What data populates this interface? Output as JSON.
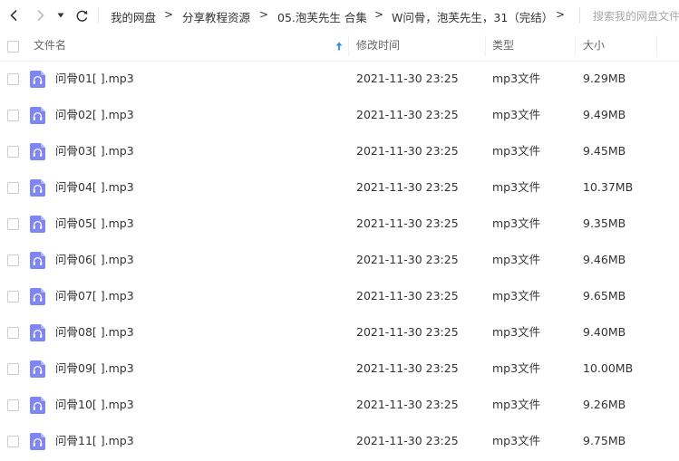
{
  "toolbar": {
    "breadcrumbs": [
      "我的网盘",
      "分享教程资源",
      "05.泡芙先生 合集",
      "W问骨，泡芙先生，31（完结）"
    ],
    "separator": ">",
    "search_placeholder": "搜索我的网盘文件"
  },
  "columns": {
    "name": "文件名",
    "modified": "修改时间",
    "type": "类型",
    "size": "大小"
  },
  "files": [
    {
      "name": "问骨01[ ].mp3",
      "modified": "2021-11-30 23:25",
      "type": "mp3文件",
      "size": "9.29MB"
    },
    {
      "name": "问骨02[ ].mp3",
      "modified": "2021-11-30 23:25",
      "type": "mp3文件",
      "size": "9.49MB"
    },
    {
      "name": "问骨03[ ].mp3",
      "modified": "2021-11-30 23:25",
      "type": "mp3文件",
      "size": "9.45MB"
    },
    {
      "name": "问骨04[ ].mp3",
      "modified": "2021-11-30 23:25",
      "type": "mp3文件",
      "size": "10.37MB"
    },
    {
      "name": "问骨05[ ].mp3",
      "modified": "2021-11-30 23:25",
      "type": "mp3文件",
      "size": "9.35MB"
    },
    {
      "name": "问骨06[ ].mp3",
      "modified": "2021-11-30 23:25",
      "type": "mp3文件",
      "size": "9.46MB"
    },
    {
      "name": "问骨07[ ].mp3",
      "modified": "2021-11-30 23:25",
      "type": "mp3文件",
      "size": "9.65MB"
    },
    {
      "name": "问骨08[ ].mp3",
      "modified": "2021-11-30 23:25",
      "type": "mp3文件",
      "size": "9.40MB"
    },
    {
      "name": "问骨09[ ].mp3",
      "modified": "2021-11-30 23:25",
      "type": "mp3文件",
      "size": "10.00MB"
    },
    {
      "name": "问骨10[ ].mp3",
      "modified": "2021-11-30 23:25",
      "type": "mp3文件",
      "size": "9.26MB"
    },
    {
      "name": "问骨11[ ].mp3",
      "modified": "2021-11-30 23:25",
      "type": "mp3文件",
      "size": "9.75MB"
    }
  ],
  "colors": {
    "icon_fill": "#7e86f3",
    "sort_arrow": "#2d8cf0",
    "text": "#333333",
    "muted": "#666666"
  },
  "icons": [
    "chevron-left-icon",
    "chevron-right-icon",
    "caret-down-icon",
    "refresh-icon",
    "sort-up-icon",
    "audio-file-icon"
  ]
}
